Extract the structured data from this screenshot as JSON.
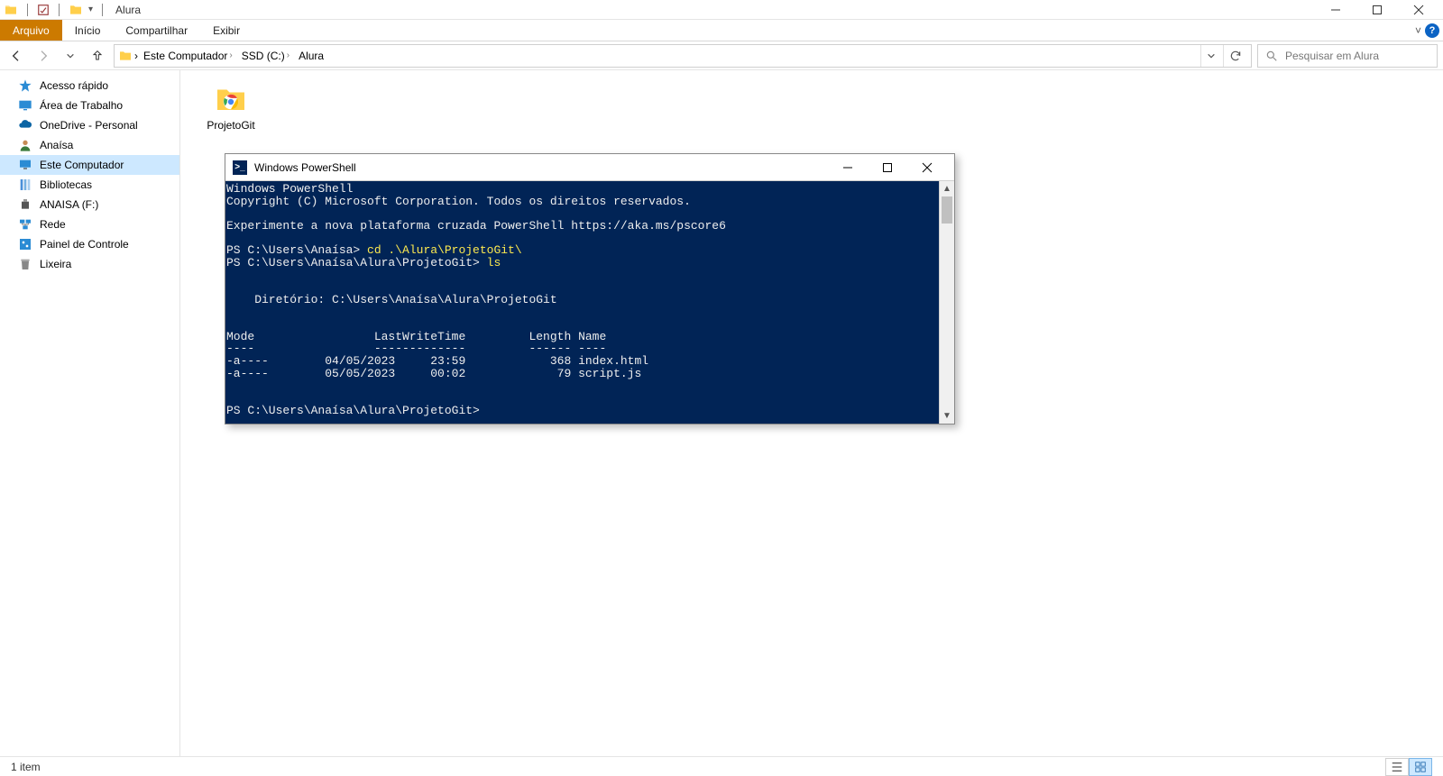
{
  "window": {
    "title": "Alura"
  },
  "ribbon": {
    "tabs": {
      "file": "Arquivo",
      "home": "Início",
      "share": "Compartilhar",
      "view": "Exibir"
    }
  },
  "breadcrumb": {
    "items": [
      "Este Computador",
      "SSD (C:)",
      "Alura"
    ]
  },
  "search": {
    "placeholder": "Pesquisar em Alura"
  },
  "sidebar": {
    "items": [
      {
        "label": "Acesso rápido",
        "icon": "star"
      },
      {
        "label": "Área de Trabalho",
        "icon": "desktop"
      },
      {
        "label": "OneDrive - Personal",
        "icon": "onedrive"
      },
      {
        "label": "Anaísa",
        "icon": "user"
      },
      {
        "label": "Este Computador",
        "icon": "monitor",
        "selected": true
      },
      {
        "label": "Bibliotecas",
        "icon": "libs"
      },
      {
        "label": "ANAISA (F:)",
        "icon": "usb"
      },
      {
        "label": "Rede",
        "icon": "network"
      },
      {
        "label": "Painel de Controle",
        "icon": "control"
      },
      {
        "label": "Lixeira",
        "icon": "trash"
      }
    ]
  },
  "content": {
    "files": [
      {
        "name": "ProjetoGit",
        "icon": "chrome"
      }
    ]
  },
  "status": {
    "text": "1 item"
  },
  "ps": {
    "title": "Windows PowerShell",
    "lines": [
      {
        "t": "Windows PowerShell"
      },
      {
        "t": "Copyright (C) Microsoft Corporation. Todos os direitos reservados."
      },
      {
        "t": ""
      },
      {
        "t": "Experimente a nova plataforma cruzada PowerShell https://aka.ms/pscore6"
      },
      {
        "t": ""
      },
      {
        "prompt": "PS C:\\Users\\Anaísa> ",
        "cmd": "cd .\\Alura\\ProjetoGit\\"
      },
      {
        "prompt": "PS C:\\Users\\Anaísa\\Alura\\ProjetoGit> ",
        "cmd": "ls"
      },
      {
        "t": ""
      },
      {
        "t": ""
      },
      {
        "t": "    Diretório: C:\\Users\\Anaísa\\Alura\\ProjetoGit"
      },
      {
        "t": ""
      },
      {
        "t": ""
      },
      {
        "t": "Mode                 LastWriteTime         Length Name"
      },
      {
        "t": "----                 -------------         ------ ----"
      },
      {
        "t": "-a----        04/05/2023     23:59            368 index.html"
      },
      {
        "t": "-a----        05/05/2023     00:02             79 script.js"
      },
      {
        "t": ""
      },
      {
        "t": ""
      },
      {
        "prompt": "PS C:\\Users\\Anaísa\\Alura\\ProjetoGit> ",
        "cmd": ""
      }
    ]
  }
}
